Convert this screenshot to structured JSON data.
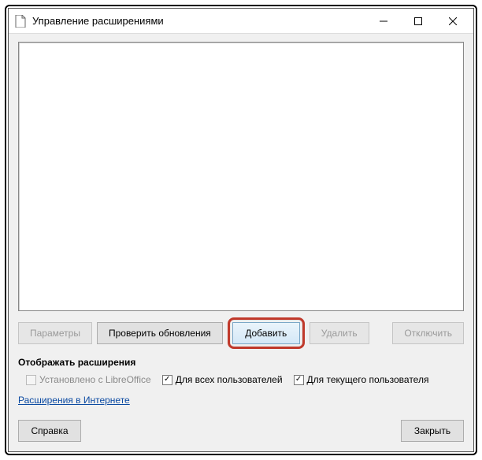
{
  "window": {
    "title": "Управление расширениями"
  },
  "buttons": {
    "options": "Параметры",
    "check_updates": "Проверить обновления",
    "add": "Добавить",
    "remove": "Удалить",
    "disable": "Отключить",
    "help": "Справка",
    "close": "Закрыть"
  },
  "section": {
    "display_label": "Отображать расширения"
  },
  "checkboxes": {
    "bundled": "Установлено с LibreOffice",
    "all_users": "Для всех пользователей",
    "current_user": "Для текущего пользователя"
  },
  "link": {
    "online": "Расширения в Интернете"
  }
}
